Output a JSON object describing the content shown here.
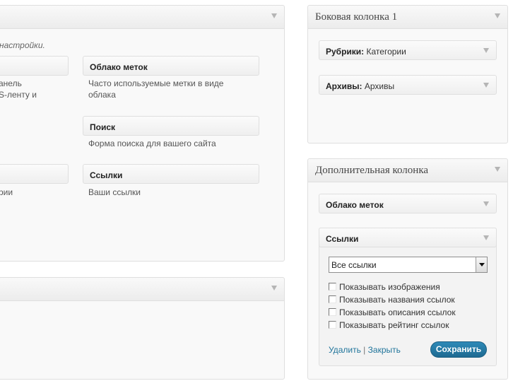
{
  "available": {
    "intro": "настройки.",
    "widgets": [
      {
        "title": "Облако меток",
        "desc": [
          "Часто используемые метки в виде",
          "облака"
        ]
      },
      {
        "title": "Поиск",
        "desc": [
          "Форма поиска для вашего сайта"
        ]
      },
      {
        "title": "Ссылки",
        "desc": [
          "Ваши ссылки"
        ]
      }
    ],
    "partial_desc": [
      "анель",
      "S-ленту и",
      "рии"
    ]
  },
  "sidebar1": {
    "title": "Боковая колонка 1",
    "widgets": [
      {
        "name": "Рубрики:",
        "sub": "Категории"
      },
      {
        "name": "Архивы:",
        "sub": "Архивы"
      }
    ]
  },
  "sidebar2": {
    "title": "Дополнительная колонка",
    "widgets": [
      {
        "name": "Облако меток"
      },
      {
        "name": "Ссылки"
      }
    ],
    "links_form": {
      "select_value": "Все ссылки",
      "checkboxes": [
        "Показывать изображения",
        "Показывать названия ссылок",
        "Показывать описания ссылок",
        "Показывать рейтинг ссылок"
      ],
      "delete_label": "Удалить",
      "separator": "|",
      "close_label": "Закрыть",
      "save_label": "Сохранить"
    }
  },
  "colors": {
    "accent": "#21759b",
    "button": "#1e6a91"
  },
  "icons": [
    "toggle-arrow-icon",
    "checkbox-icon",
    "dropdown-arrow-icon"
  ]
}
